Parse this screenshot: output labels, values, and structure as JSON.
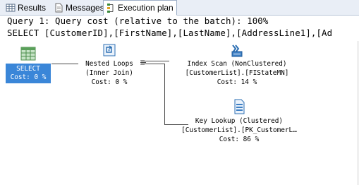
{
  "tabs": [
    {
      "label": "Results",
      "icon": "grid-icon"
    },
    {
      "label": "Messages",
      "icon": "document-icon"
    },
    {
      "label": "Execution plan",
      "icon": "execution-plan-icon"
    }
  ],
  "query": {
    "cost_line": "Query 1: Query cost (relative to the batch): 100%",
    "sql_line": "SELECT [CustomerID],[FirstName],[LastName],[AddressLine1],[Ad"
  },
  "plan": {
    "select": {
      "label": "SELECT",
      "cost": "Cost: 0 %",
      "icon": "result-table-icon"
    },
    "nested_loops": {
      "name": "Nested Loops",
      "detail": "(Inner Join)",
      "cost": "Cost: 0 %",
      "icon": "nested-loops-icon"
    },
    "index_scan": {
      "name": "Index Scan (NonClustered)",
      "object": "[CustomerList].[FIStateMN]",
      "cost": "Cost: 14 %",
      "icon": "index-scan-icon"
    },
    "key_lookup": {
      "name": "Key Lookup (Clustered)",
      "object": "[CustomerList].[PK_CustomerL…",
      "cost": "Cost: 86 %",
      "icon": "key-lookup-icon"
    }
  },
  "colors": {
    "selection": "#3a86d8",
    "tab_bar": "#e9eef6",
    "connector": "#4a4a4a"
  }
}
